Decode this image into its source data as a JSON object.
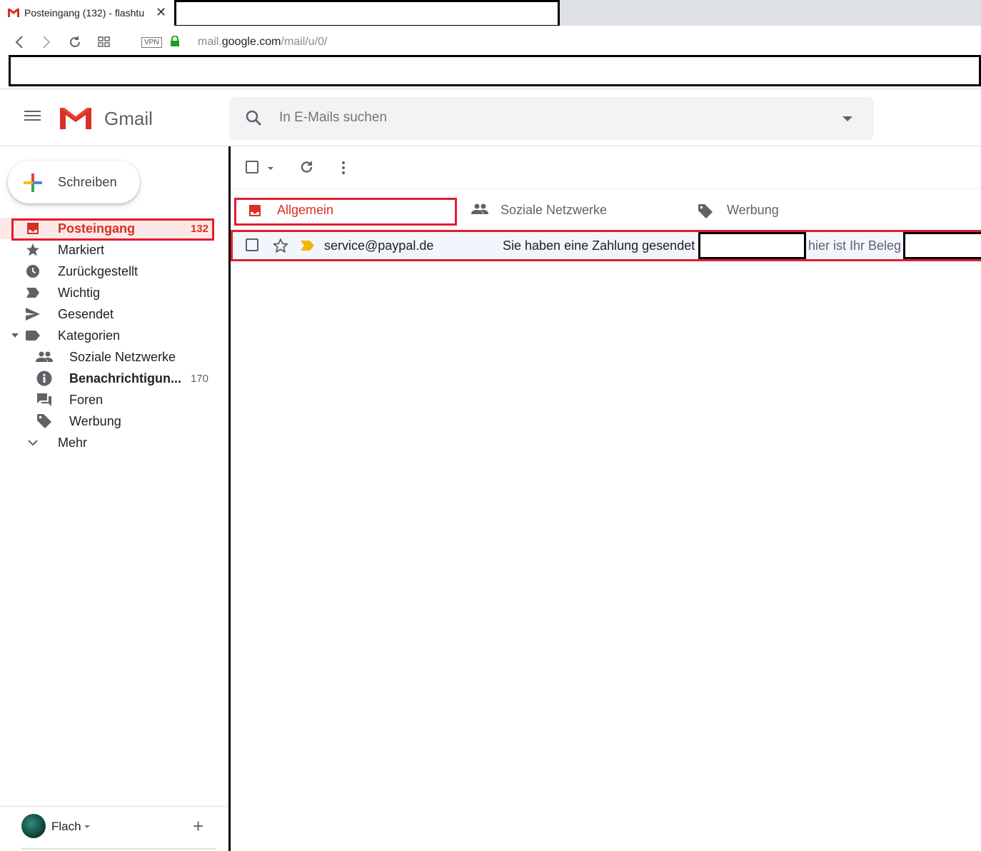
{
  "browser": {
    "tab_title": "Posteingang (132) - flashtu",
    "url_prefix": "mail.",
    "url_domain": "google.com",
    "url_path": "/mail/u/0/",
    "vpn_label": "VPN"
  },
  "header": {
    "logo_text": "Gmail",
    "search_placeholder": "In E-Mails suchen"
  },
  "sidebar": {
    "compose_label": "Schreiben",
    "items": [
      {
        "label": "Posteingang",
        "count": "132",
        "icon": "inbox-icon",
        "active": true
      },
      {
        "label": "Markiert",
        "icon": "star-icon"
      },
      {
        "label": "Zurückgestellt",
        "icon": "clock-icon"
      },
      {
        "label": "Wichtig",
        "icon": "important-icon"
      },
      {
        "label": "Gesendet",
        "icon": "send-icon"
      },
      {
        "label": "Kategorien",
        "icon": "label-icon"
      },
      {
        "label": "Soziale Netzwerke",
        "icon": "people-icon"
      },
      {
        "label": "Benachrichtigun...",
        "count": "170",
        "icon": "info-icon"
      },
      {
        "label": "Foren",
        "icon": "forum-icon"
      },
      {
        "label": "Werbung",
        "icon": "tag-icon"
      },
      {
        "label": "Mehr",
        "icon": "chevron-down-icon"
      }
    ],
    "account_name": "Flach"
  },
  "main": {
    "tabs": [
      {
        "label": "Allgemein",
        "icon": "inbox-icon",
        "active": true
      },
      {
        "label": "Soziale Netzwerke",
        "icon": "people-icon"
      },
      {
        "label": "Werbung",
        "icon": "tag-icon"
      }
    ],
    "emails": [
      {
        "sender": "service@paypal.de",
        "subject": "Sie haben eine Zahlung gesendet -",
        "snippet": "hier ist Ihr Beleg"
      }
    ]
  },
  "colors": {
    "accent_red": "#d93025",
    "highlight_red": "#e01e2e",
    "important_yellow": "#f4b400"
  }
}
